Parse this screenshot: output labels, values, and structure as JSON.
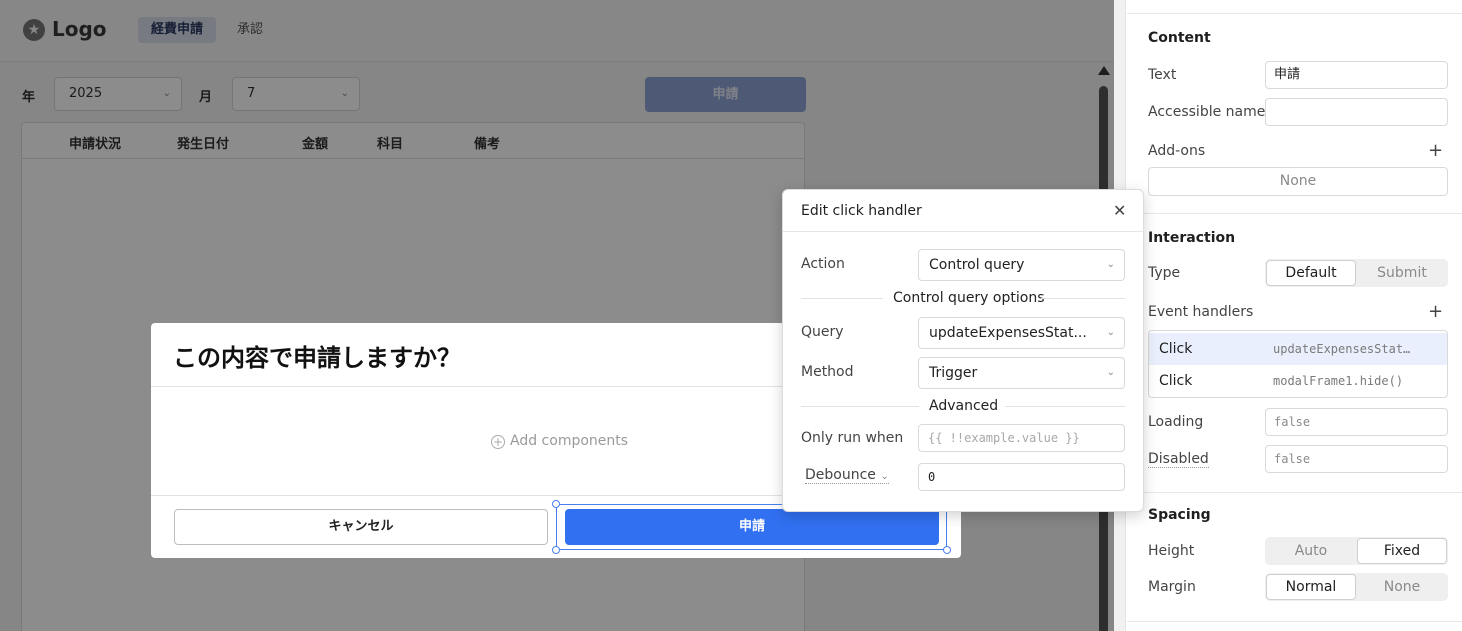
{
  "app": {
    "logo_text": "Logo",
    "nav_tabs": [
      "経費申請",
      "承認"
    ]
  },
  "filters": {
    "year_label": "年",
    "year_value": "2025",
    "month_label": "月",
    "month_value": "7",
    "apply_label": "申請"
  },
  "table": {
    "columns": [
      "申請状況",
      "発生日付",
      "金額",
      "科目",
      "備考"
    ]
  },
  "confirm_modal": {
    "title": "この内容で申請しますか？",
    "add_components": "Add components",
    "cancel_label": "キャンセル",
    "submit_label": "申請"
  },
  "handler_popover": {
    "title": "Edit click handler",
    "action_label": "Action",
    "action_value": "Control query",
    "options_section": "Control query options",
    "query_label": "Query",
    "query_value": "updateExpensesStat...",
    "method_label": "Method",
    "method_value": "Trigger",
    "advanced_section": "Advanced",
    "only_run_label": "Only run when",
    "only_run_placeholder": "{{ !!example.value }}",
    "debounce_label": "Debounce",
    "debounce_value": "0"
  },
  "inspector": {
    "content_title": "Content",
    "text_label": "Text",
    "text_value": "申請",
    "accessible_label": "Accessible name",
    "accessible_value": "",
    "addons_label": "Add-ons",
    "addons_value": "None",
    "interaction_title": "Interaction",
    "type_label": "Type",
    "type_options": [
      "Default",
      "Submit"
    ],
    "event_handlers_label": "Event handlers",
    "event_handlers": [
      {
        "event": "Click",
        "query": "updateExpensesStat…"
      },
      {
        "event": "Click",
        "query": "modalFrame1.hide()"
      }
    ],
    "loading_label": "Loading",
    "loading_value": "false",
    "disabled_label": "Disabled",
    "disabled_value": "false",
    "spacing_title": "Spacing",
    "height_label": "Height",
    "height_options": [
      "Auto",
      "Fixed"
    ],
    "margin_label": "Margin",
    "margin_options": [
      "Normal",
      "None"
    ]
  },
  "colors": {
    "primary": "#3170f1",
    "primary_disabled": "#8ea2d6",
    "selection": "#4a7ff0"
  }
}
